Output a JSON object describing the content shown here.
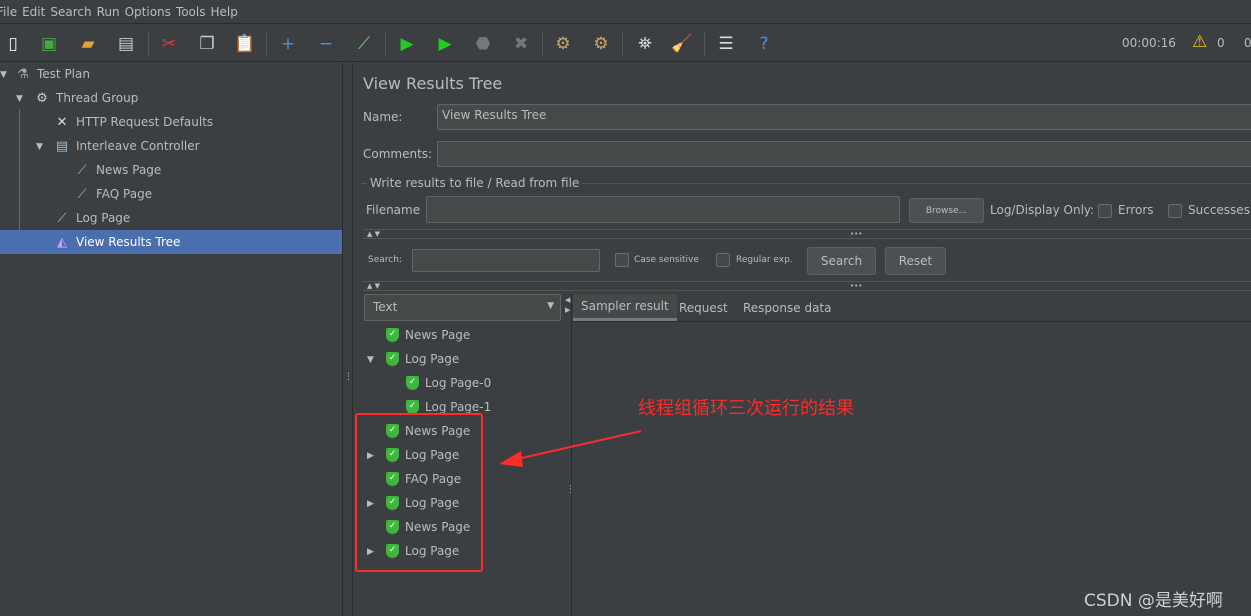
{
  "menu": [
    "File",
    "Edit",
    "Search",
    "Run",
    "Options",
    "Tools",
    "Help"
  ],
  "toolbar": {
    "timer": "00:00:16",
    "warnings": "0",
    "errors_count": "0"
  },
  "tree": [
    {
      "label": "Test Plan",
      "icon": "flask-icon"
    },
    {
      "label": "Thread Group",
      "icon": "gear-icon"
    },
    {
      "label": "HTTP Request Defaults",
      "icon": "wrench-icon"
    },
    {
      "label": "Interleave Controller",
      "icon": "controller-icon"
    },
    {
      "label": "News Page",
      "icon": "pipette-icon"
    },
    {
      "label": "FAQ Page",
      "icon": "pipette-icon"
    },
    {
      "label": "Log Page",
      "icon": "pipette-icon"
    },
    {
      "label": "View Results Tree",
      "icon": "chart-icon"
    }
  ],
  "panel": {
    "title": "View Results Tree",
    "name_label": "Name:",
    "name_value": "View Results Tree",
    "comments_label": "Comments:",
    "comments_value": "",
    "file_group": "Write results to file / Read from file",
    "filename_label": "Filename",
    "filename_value": "",
    "browse": "Browse...",
    "log_display": "Log/Display Only:",
    "errors": "Errors",
    "successes": "Successes"
  },
  "search": {
    "label": "Search:",
    "value": "",
    "case_sensitive": "Case sensitive",
    "regex": "Regular exp.",
    "search_btn": "Search",
    "reset_btn": "Reset"
  },
  "renderer": "Text",
  "tabs": [
    "Sampler result",
    "Request",
    "Response data"
  ],
  "results": [
    {
      "label": "News Page",
      "level": 0,
      "expander": ""
    },
    {
      "label": "Log Page",
      "level": 0,
      "expander": "expanded"
    },
    {
      "label": "Log Page-0",
      "level": 1,
      "expander": ""
    },
    {
      "label": "Log Page-1",
      "level": 1,
      "expander": ""
    },
    {
      "label": "News Page",
      "level": 0,
      "expander": ""
    },
    {
      "label": "Log Page",
      "level": 0,
      "expander": "collapsed"
    },
    {
      "label": "FAQ Page",
      "level": 0,
      "expander": ""
    },
    {
      "label": "Log Page",
      "level": 0,
      "expander": "collapsed"
    },
    {
      "label": "News Page",
      "level": 0,
      "expander": ""
    },
    {
      "label": "Log Page",
      "level": 0,
      "expander": "collapsed"
    }
  ],
  "annotation": "线程组循环三次运行的结果",
  "watermark": "CSDN @是美好啊",
  "colors": {
    "background": "#3c3f41",
    "selection": "#4b6eaf",
    "success": "#3db83d",
    "annotation": "#ff2a2a"
  }
}
